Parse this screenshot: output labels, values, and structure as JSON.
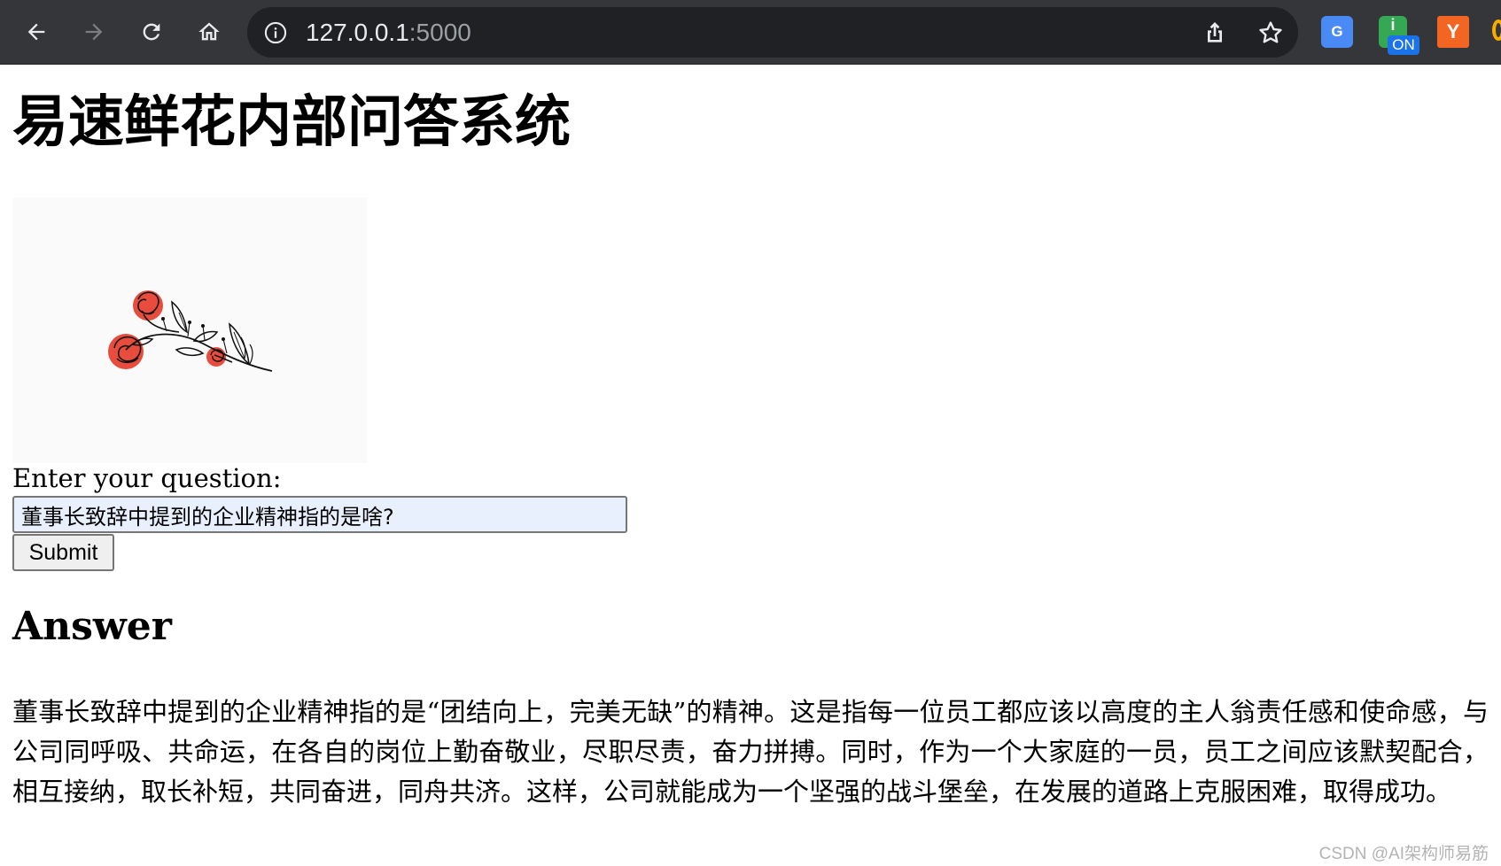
{
  "browser": {
    "url_host": "127.0.0.1",
    "url_port": ":5000",
    "extensions": [
      {
        "name": "translate-extension",
        "label": "G"
      },
      {
        "name": "on-extension",
        "label": "ON"
      },
      {
        "name": "y-extension",
        "label": "Y"
      }
    ]
  },
  "page": {
    "title": "易速鲜花内部问答系统",
    "question_label": "Enter your question:",
    "question_value": "董事长致辞中提到的企业精神指的是啥?",
    "submit_label": "Submit",
    "answer_heading": "Answer",
    "answer_text": "董事长致辞中提到的企业精神指的是“团结向上，完美无缺”的精神。这是指每一位员工都应该以高度的主人翁责任感和使命感，与公司同呼吸、共命运，在各自的岗位上勤奋敬业，尽职尽责，奋力拼搏。同时，作为一个大家庭的一员，员工之间应该默契配合，相互接纳，取长补短，共同奋进，同舟共济。这样，公司就能成为一个坚强的战斗堡垒，在发展的道路上克服困难，取得成功。",
    "watermark": "CSDN @AI架构师易筋"
  },
  "colors": {
    "chrome_bg": "#35363a",
    "omnibox_bg": "#202124",
    "input_autofill_bg": "#e8f0fe",
    "flower_red": "#e74c3c"
  }
}
